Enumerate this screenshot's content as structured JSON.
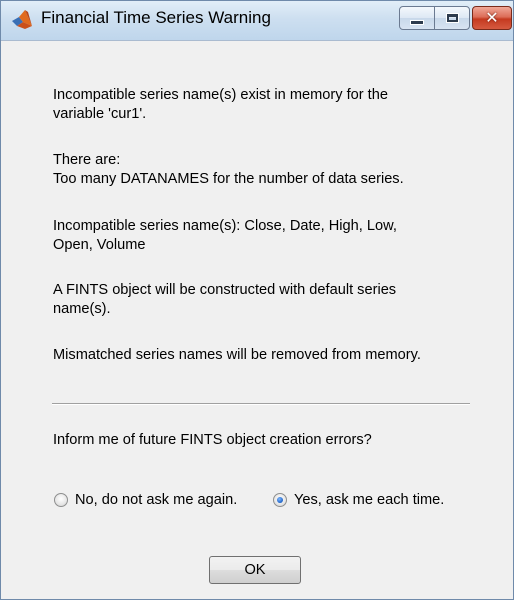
{
  "window": {
    "title": "Financial Time Series Warning",
    "icon": "matlab-logo-icon",
    "controls": {
      "minimize_icon": "minimize-icon",
      "maximize_icon": "maximize-icon",
      "close_icon": "close-icon",
      "close_glyph": "✕"
    },
    "accent_colors": {
      "titlebar": "#cddff0",
      "close_button": "#c53a20",
      "radio_selected": "#1f63c6"
    }
  },
  "message": {
    "para1_line1": "Incompatible series name(s) exist in memory for the",
    "para1_line2": "variable 'cur1'.",
    "para2_line1": "There are:",
    "para2_line2": "Too many DATANAMES for the number of data series.",
    "para3_line1": "Incompatible series name(s): Close, Date, High, Low,",
    "para3_line2": "Open, Volume",
    "para4_line1": "A FINTS object will be constructed with default series",
    "para4_line2": "name(s).",
    "para5": "Mismatched series names will be removed from memory."
  },
  "question": "Inform me of future FINTS object creation errors?",
  "options": {
    "no_label": "No, do not ask me again.",
    "yes_label": "Yes, ask me each time.",
    "selected": "Yes, ask me each time."
  },
  "ok_label": "OK"
}
